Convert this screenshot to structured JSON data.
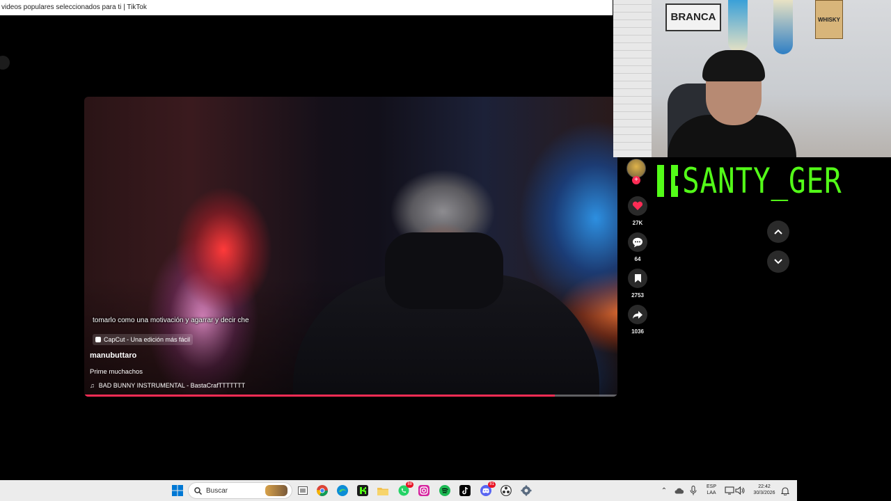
{
  "window": {
    "title": "videos populares seleccionados para ti | TikTok"
  },
  "video": {
    "subtitle": "tomarlo como una motivación y agarrar y decir che",
    "capcut_label": "CapCut - Una edición más fácil",
    "username": "manubuttaro",
    "caption": "Prime muchachos",
    "music": "BAD BUNNY INSTRUMENTAL - BastaCrafTTTTTTT",
    "progress": 0.882
  },
  "actions": {
    "likes": "27K",
    "comments": "64",
    "saves": "2753",
    "shares": "1036"
  },
  "stream_overlay": {
    "name": "SANTY_GER",
    "brand_color": "#53fc18"
  },
  "webcam": {
    "sign_branca": "BRANCA",
    "sign_whisky": "WHISKY"
  },
  "taskbar": {
    "search_placeholder": "Buscar",
    "lang_top": "ESP",
    "lang_bottom": "LAA",
    "time": "22:42",
    "date": "30/3/2026",
    "whatsapp_badge": "88",
    "discord_badge": "81",
    "icons": [
      "windows-start",
      "search",
      "file-explorer-widget",
      "task-view",
      "chrome",
      "edge",
      "kick",
      "folder",
      "whatsapp",
      "instagram",
      "spotify",
      "tiktok",
      "discord",
      "obs",
      "settings"
    ]
  },
  "colors": {
    "tiktok_red": "#fe2c55",
    "kick_green": "#53fc18"
  }
}
